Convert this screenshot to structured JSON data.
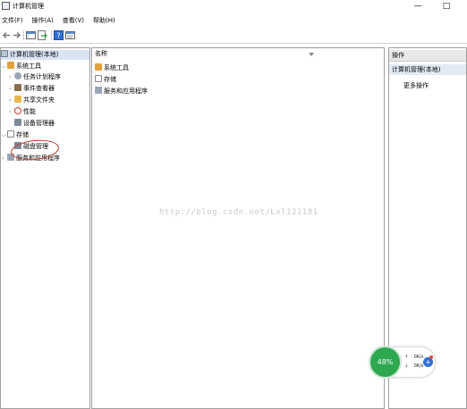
{
  "window": {
    "title": "计算机管理",
    "minimize": "—",
    "maximize": "□"
  },
  "menu": [
    "文件(F)",
    "操作(A)",
    "查看(V)",
    "帮助(H)"
  ],
  "tree": {
    "root": "计算机管理(本地)",
    "nodes": [
      {
        "label": "系统工具",
        "icon": "tools-icon"
      },
      {
        "label": "任务计划程序",
        "icon": "clock-icon"
      },
      {
        "label": "事件查看器",
        "icon": "event-viewer-icon"
      },
      {
        "label": "共享文件夹",
        "icon": "shared-folder-icon"
      },
      {
        "label": "性能",
        "icon": "performance-icon"
      },
      {
        "label": "设备管理器",
        "icon": "device-manager-icon"
      },
      {
        "label": "存储",
        "icon": "storage-icon"
      },
      {
        "label": "磁盘管理",
        "icon": "disk-icon"
      },
      {
        "label": "服务和应用程序",
        "icon": "services-icon"
      }
    ]
  },
  "list": {
    "column_header": "名称",
    "items": [
      "系统工具",
      "存储",
      "服务和应用程序"
    ]
  },
  "actions": {
    "header": "操作",
    "selected": "计算机管理(本地)",
    "more": "更多操作"
  },
  "watermark": "http://blog.csdn.net/Lxl121181",
  "net_widget": {
    "percent": "48%",
    "up": "0K/s",
    "down": "0K/s",
    "up_arrow": "↑",
    "down_arrow": "↓"
  },
  "colors": {
    "accent": "#2d6fd6",
    "gauge": "#2ea84f",
    "annotation": "#c0392b"
  }
}
